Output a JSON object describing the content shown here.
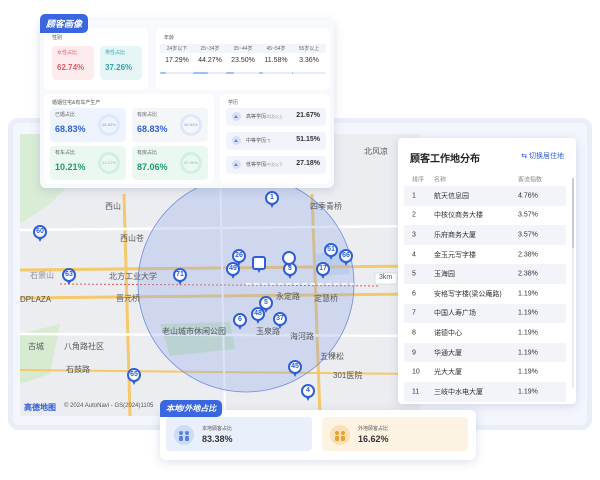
{
  "customer_portrait": {
    "badge": "顾客画像",
    "gender": {
      "title": "性别",
      "items": [
        {
          "label": "女性占比",
          "value": "62.74%"
        },
        {
          "label": "男性占比",
          "value": "37.26%"
        }
      ]
    },
    "age": {
      "title": "年龄",
      "items": [
        {
          "label": "24岁以下",
          "value": "17.29%",
          "fraction": 0.17
        },
        {
          "label": "25~34岁",
          "value": "44.27%",
          "fraction": 0.44
        },
        {
          "label": "35~44岁",
          "value": "23.50%",
          "fraction": 0.24
        },
        {
          "label": "45~54岁",
          "value": "11.58%",
          "fraction": 0.12
        },
        {
          "label": "55岁以上",
          "value": "3.36%",
          "fraction": 0.03
        }
      ]
    },
    "assets": {
      "title": "婚姻住宅&有车产生产",
      "items": [
        {
          "label": "已婚占比",
          "value": "68.83%",
          "ring": "68.83%"
        },
        {
          "label": "有房占比",
          "value": "68.83%",
          "ring": "68.83%"
        },
        {
          "label": "有车占比",
          "value": "10.21%",
          "ring": "10.21%"
        },
        {
          "label": "有房占比",
          "value": "87.06%",
          "ring": "87.06%"
        }
      ]
    },
    "education": {
      "title": "学历",
      "items": [
        {
          "label": "高等学历",
          "sub": "本科及以上",
          "value": "21.67%"
        },
        {
          "label": "中等学历",
          "sub": "大专",
          "value": "51.15%"
        },
        {
          "label": "低等学历",
          "sub": "高中及以下",
          "value": "27.18%"
        }
      ]
    }
  },
  "work_distribution": {
    "title": "顾客工作地分布",
    "switch_label": "切换居住地",
    "columns": [
      "排序",
      "名称",
      "客流指数"
    ],
    "rows": [
      {
        "rank": "1",
        "name": "航天信息园",
        "index": "4.76%"
      },
      {
        "rank": "2",
        "name": "中核仪商务大楼",
        "index": "3.57%"
      },
      {
        "rank": "3",
        "name": "乐府商务大厦",
        "index": "3.57%"
      },
      {
        "rank": "4",
        "name": "金玉元写字楼",
        "index": "2.38%"
      },
      {
        "rank": "5",
        "name": "玉海园",
        "index": "2.38%"
      },
      {
        "rank": "6",
        "name": "安格写字楼(梁公庵路)",
        "index": "1.19%"
      },
      {
        "rank": "7",
        "name": "中国人寿广场",
        "index": "1.19%"
      },
      {
        "rank": "8",
        "name": "诺德中心",
        "index": "1.19%"
      },
      {
        "rank": "9",
        "name": "华通大厦",
        "index": "1.19%"
      },
      {
        "rank": "10",
        "name": "光大大厦",
        "index": "1.19%"
      },
      {
        "rank": "11",
        "name": "三岐中水电大厦",
        "index": "1.19%"
      }
    ]
  },
  "local_ratio": {
    "badge": "本地/外地占比",
    "local": {
      "label": "本地顾客占比",
      "value": "83.38%"
    },
    "outside": {
      "label": "外地顾客占比",
      "value": "16.62%"
    }
  },
  "map": {
    "places": [
      "西山",
      "西山苍",
      "四季青桥",
      "北方工业大学",
      "晋元桥",
      "定慧桥",
      "老山城市休闲公园",
      "玉泉路",
      "永定路",
      "海河路",
      "石景山",
      "八角路社区",
      "古城",
      "石鼓路",
      "五棵松",
      "301医院",
      "DPLAZA",
      "高德地图",
      "© 2024 AutoNavi - GS(2024)1105",
      "3km",
      "北",
      "风凉"
    ],
    "markers": [
      "1",
      "60",
      "63",
      "71",
      "26",
      "49",
      "3",
      "17",
      "51",
      "66",
      "5",
      "48",
      "6",
      "37",
      "65",
      "45",
      "4"
    ]
  },
  "colors": {
    "accent": "#3a67e0",
    "female": "#e05a6a",
    "male": "#2aa6b0",
    "local": "#3a67e0",
    "outside": "#e8a236"
  }
}
